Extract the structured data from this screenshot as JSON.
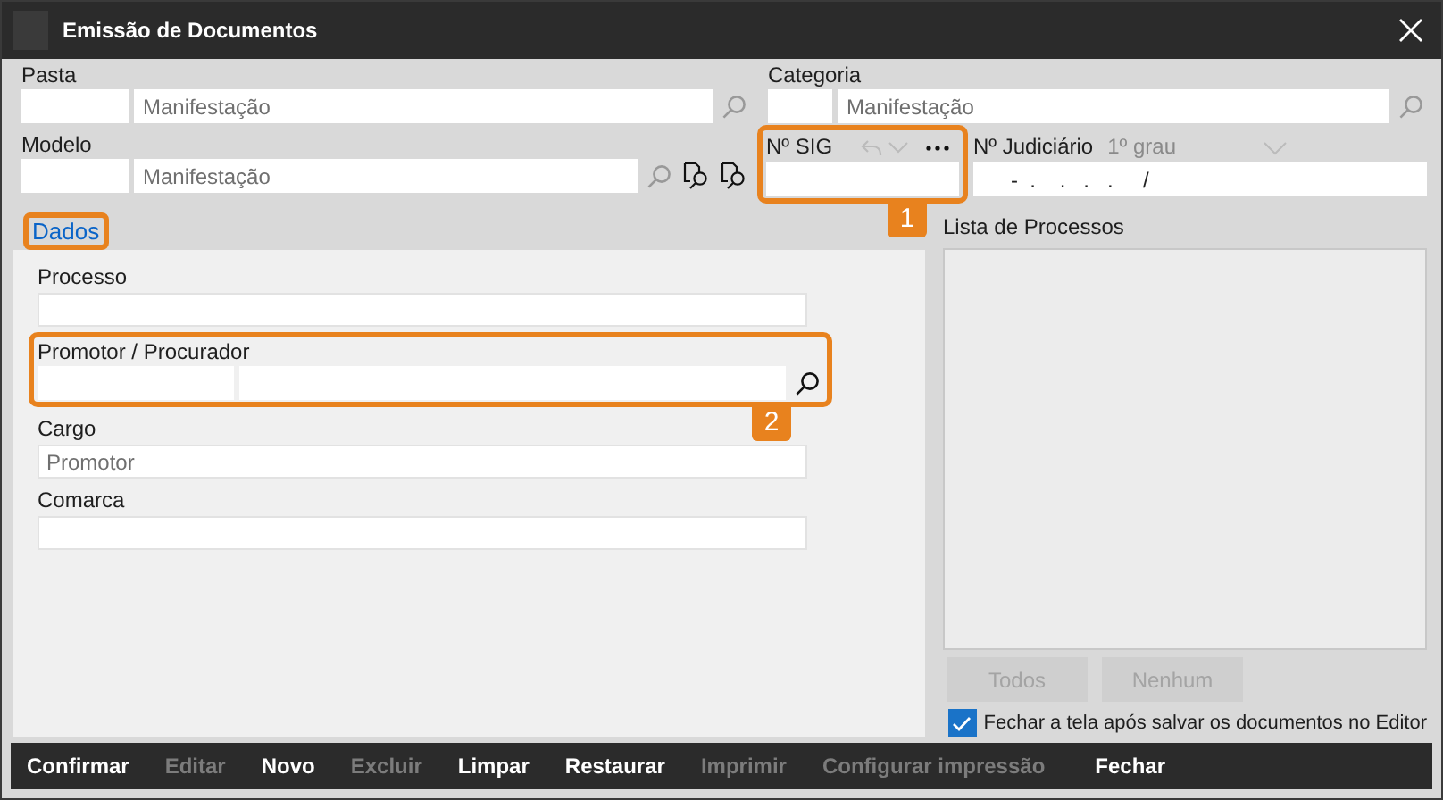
{
  "window": {
    "title": "Emissão de Documentos"
  },
  "pasta": {
    "label": "Pasta",
    "value": "Manifestação"
  },
  "categoria": {
    "label": "Categoria",
    "value": "Manifestação"
  },
  "modelo": {
    "label": "Modelo",
    "value": "Manifestação"
  },
  "sig": {
    "label": "Nº SIG",
    "highlighted": true,
    "callout": "1"
  },
  "judiciario": {
    "label": "Nº Judiciário",
    "instance": "1º grau",
    "value": "-  .    .   .   .     /"
  },
  "tabs": [
    {
      "label": "Dados",
      "selected": true,
      "highlighted": true
    }
  ],
  "dados": {
    "processo": {
      "label": "Processo"
    },
    "promotor": {
      "label": "Promotor / Procurador",
      "highlighted": true,
      "callout": "2"
    },
    "cargo": {
      "label": "Cargo",
      "value": "Promotor"
    },
    "comarca": {
      "label": "Comarca"
    }
  },
  "processos": {
    "title": "Lista de Processos",
    "buttons": [
      {
        "label": "Todos",
        "disabled": true
      },
      {
        "label": "Nenhum",
        "disabled": true
      }
    ]
  },
  "close_option": {
    "label": "Fechar a tela após salvar os documentos no Editor",
    "checked": true
  },
  "toolbar": [
    {
      "label": "Confirmar",
      "disabled": false
    },
    {
      "label": "Editar",
      "disabled": true
    },
    {
      "label": "Novo",
      "disabled": false
    },
    {
      "label": "Excluir",
      "disabled": true
    },
    {
      "label": "Limpar",
      "disabled": false
    },
    {
      "label": "Restaurar",
      "disabled": false
    },
    {
      "label": "Imprimir",
      "disabled": true
    },
    {
      "label": "Configurar impressão",
      "disabled": true
    },
    {
      "label": "Fechar",
      "disabled": false
    }
  ]
}
